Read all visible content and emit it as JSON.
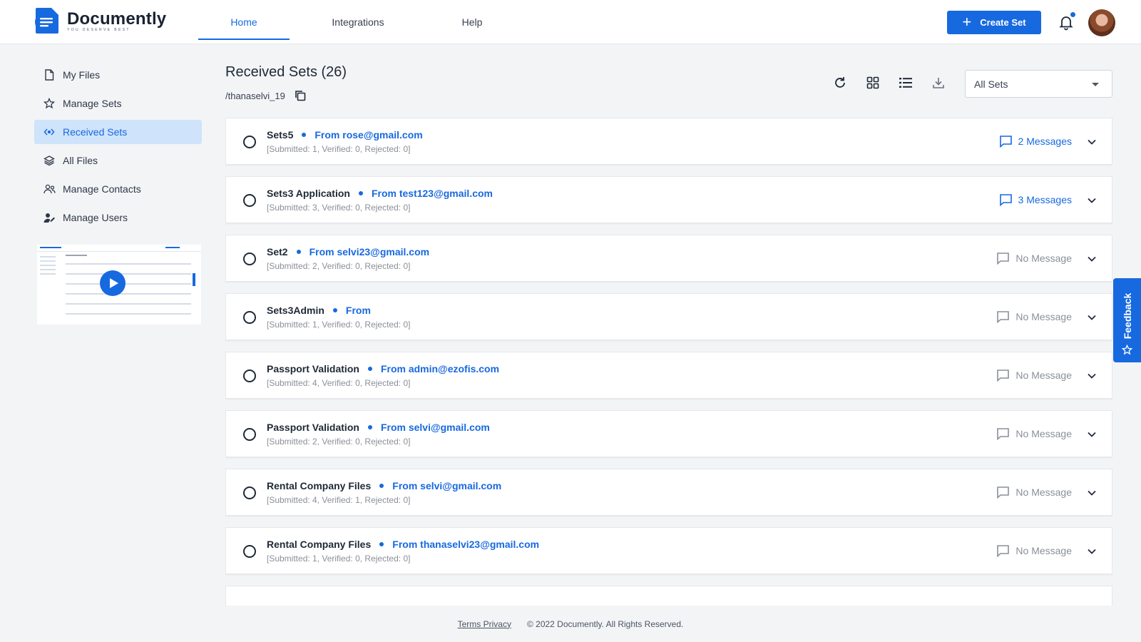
{
  "brand": {
    "name": "Documently",
    "tagline": "YOU DESERVE BEST"
  },
  "nav": {
    "tabs": [
      {
        "label": "Home",
        "active": true
      },
      {
        "label": "Integrations",
        "active": false
      },
      {
        "label": "Help",
        "active": false
      }
    ]
  },
  "header": {
    "create_label": "Create Set"
  },
  "sidebar": {
    "items": [
      {
        "label": "My Files",
        "icon": "file-icon"
      },
      {
        "label": "Manage Sets",
        "icon": "star-icon"
      },
      {
        "label": "Received Sets",
        "icon": "received-icon",
        "active": true
      },
      {
        "label": "All Files",
        "icon": "layers-icon"
      },
      {
        "label": "Manage Contacts",
        "icon": "contacts-icon"
      },
      {
        "label": "Manage Users",
        "icon": "user-edit-icon"
      }
    ]
  },
  "main": {
    "title": "Received Sets (26)",
    "path": "/thanaselvi_19",
    "filter_value": "All Sets"
  },
  "sets": [
    {
      "name": "Sets5",
      "from": "From rose@gmail.com",
      "stats": "[Submitted: 1, Verified: 0, Rejected: 0]",
      "messages": "2 Messages",
      "has_messages": true
    },
    {
      "name": "Sets3 Application",
      "from": "From test123@gmail.com",
      "stats": "[Submitted: 3, Verified: 0, Rejected: 0]",
      "messages": "3 Messages",
      "has_messages": true
    },
    {
      "name": "Set2",
      "from": "From selvi23@gmail.com",
      "stats": "[Submitted: 2, Verified: 0, Rejected: 0]",
      "messages": "No Message",
      "has_messages": false
    },
    {
      "name": "Sets3Admin",
      "from": "From",
      "stats": "[Submitted: 1, Verified: 0, Rejected: 0]",
      "messages": "No Message",
      "has_messages": false
    },
    {
      "name": "Passport Validation",
      "from": "From admin@ezofis.com",
      "stats": "[Submitted: 4, Verified: 0, Rejected: 0]",
      "messages": "No Message",
      "has_messages": false
    },
    {
      "name": "Passport Validation",
      "from": "From selvi@gmail.com",
      "stats": "[Submitted: 2, Verified: 0, Rejected: 0]",
      "messages": "No Message",
      "has_messages": false
    },
    {
      "name": "Rental Company Files",
      "from": "From selvi@gmail.com",
      "stats": "[Submitted: 4, Verified: 1, Rejected: 0]",
      "messages": "No Message",
      "has_messages": false
    },
    {
      "name": "Rental Company Files",
      "from": "From thanaselvi23@gmail.com",
      "stats": "[Submitted: 1, Verified: 0, Rejected: 0]",
      "messages": "No Message",
      "has_messages": false
    }
  ],
  "feedback": {
    "label": "Feedback"
  },
  "footer": {
    "links": "Terms Privacy",
    "copyright": "© 2022 Documently. All Rights Reserved."
  },
  "colors": {
    "accent": "#1769e0",
    "active_bg": "#cfe3fa",
    "muted_text": "#8a8f98"
  }
}
